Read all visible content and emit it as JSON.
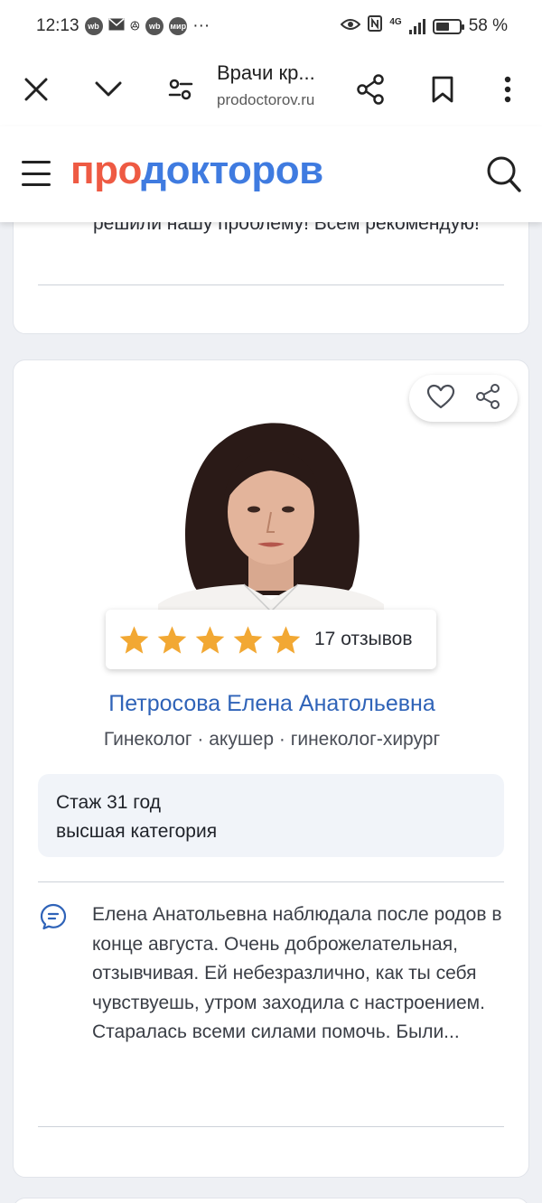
{
  "status_bar": {
    "time": "12:13",
    "network": "4G",
    "battery_percent": "58 %",
    "battery_level": 0.58
  },
  "browser": {
    "page_title": "Врачи кр...",
    "url": "prodoctorov.ru"
  },
  "site": {
    "logo_part1": "про",
    "logo_part2": "докторов"
  },
  "previous_review": {
    "text": "решили нашу проблему! Всем рекомендую!"
  },
  "doctor_card": {
    "rating_stars": 5,
    "reviews_count": "17 отзывов",
    "name": "Петросова Елена Анатольевна",
    "specialties": "Гинеколог · акушер · гинеколог-хирург",
    "experience": "Стаж 31 год",
    "category": "высшая категория",
    "review_excerpt": "Елена Анатольевна наблюдала после родов в конце августа. Очень доброжелательная, отзывчивая. Ей небезразлично, как ты себя чувствуешь, утром заходила с настроением. Старалась всеми силами помочь. Были..."
  },
  "colors": {
    "logo_red": "#ee5a43",
    "logo_blue": "#3f7be0",
    "doctor_name": "#2f63b8",
    "star": "#f2a833",
    "info_box": "#f1f4f9"
  }
}
